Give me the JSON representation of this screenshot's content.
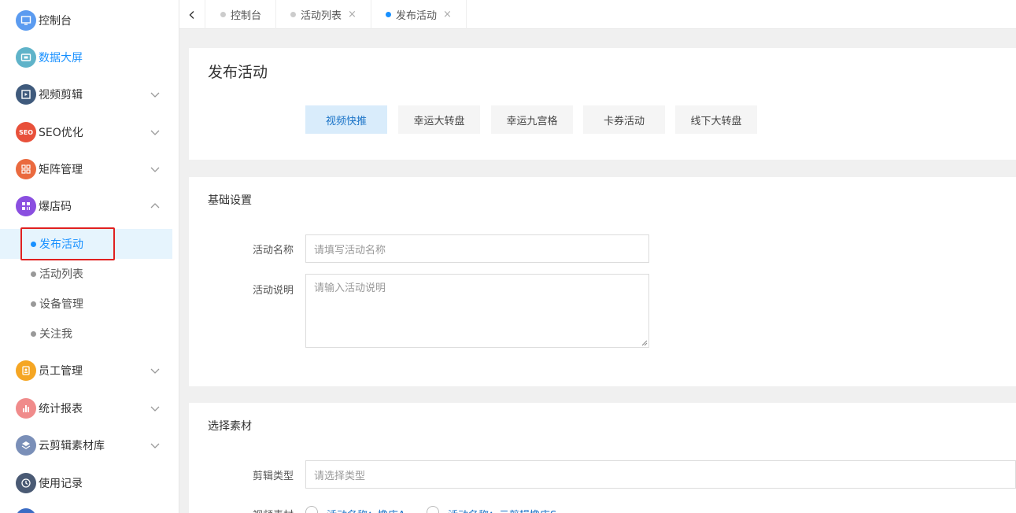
{
  "sidebar": {
    "items": [
      {
        "label": "控制台",
        "icon": "monitor-icon",
        "color": "#5b9bf0"
      },
      {
        "label": "数据大屏",
        "icon": "screen-icon",
        "color": "#5fb3c9"
      },
      {
        "label": "视频剪辑",
        "icon": "video-edit-icon",
        "color": "#3f5a7c"
      },
      {
        "label": "SEO优化",
        "icon": "seo-icon",
        "color": "#e8503a",
        "icon_text": "SEO"
      },
      {
        "label": "矩阵管理",
        "icon": "matrix-icon",
        "color": "#ea6a3f"
      },
      {
        "label": "爆店码",
        "icon": "grid-icon",
        "color": "#8a4fe0"
      },
      {
        "label": "员工管理",
        "icon": "badge-icon",
        "color": "#f5a623"
      },
      {
        "label": "统计报表",
        "icon": "chart-icon",
        "color": "#f08b8b"
      },
      {
        "label": "云剪辑素材库",
        "icon": "layers-icon",
        "color": "#7a8fb8"
      },
      {
        "label": "使用记录",
        "icon": "clock-icon",
        "color": "#4a5a74"
      }
    ],
    "sub_items": [
      {
        "label": "发布活动"
      },
      {
        "label": "活动列表"
      },
      {
        "label": "设备管理"
      },
      {
        "label": "关注我"
      }
    ]
  },
  "tabs": [
    {
      "label": "控制台"
    },
    {
      "label": "活动列表",
      "close": "×"
    },
    {
      "label": "发布活动",
      "close": "×"
    }
  ],
  "main": {
    "page_title": "发布活动",
    "activity_types": [
      "视频快推",
      "幸运大转盘",
      "幸运九宫格",
      "卡券活动",
      "线下大转盘"
    ],
    "basic": {
      "title": "基础设置",
      "name_label": "活动名称",
      "name_placeholder": "请填写活动名称",
      "desc_label": "活动说明",
      "desc_placeholder": "请输入活动说明"
    },
    "material": {
      "title": "选择素材",
      "type_label": "剪辑类型",
      "type_placeholder": "请选择类型",
      "video_label": "视频素材",
      "options": [
        "活动名称：撸店A",
        "活动名称：云剪辑撸店S"
      ]
    }
  },
  "colors": {
    "accent": "#1890ff",
    "highlight": "#e02020"
  }
}
